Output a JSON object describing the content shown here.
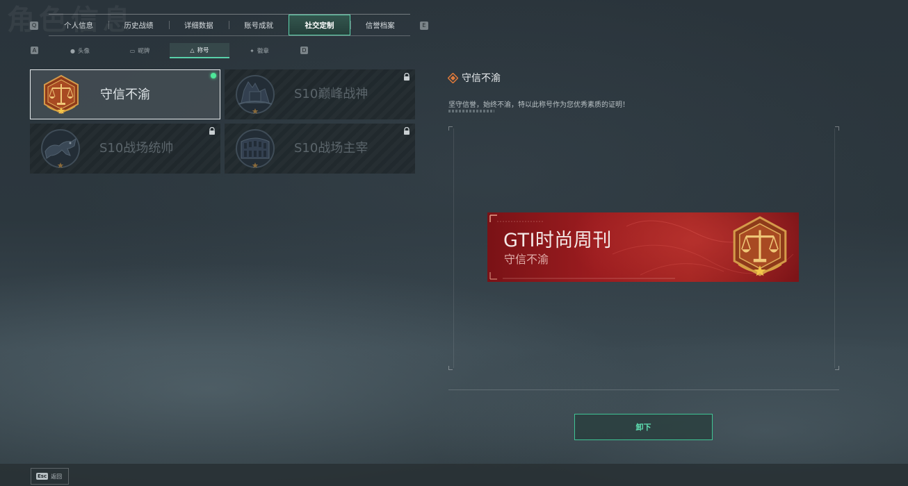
{
  "page": {
    "title": "角色信息"
  },
  "tabbar": {
    "left_key": "Q",
    "right_key": "E",
    "tabs": [
      {
        "label": "个人信息"
      },
      {
        "label": "历史战绩"
      },
      {
        "label": "详细数据"
      },
      {
        "label": "账号成就"
      },
      {
        "label": "社交定制",
        "active": true
      },
      {
        "label": "信誉档案"
      }
    ]
  },
  "subtabs": {
    "left_key": "A",
    "right_key": "D",
    "items": [
      {
        "label": "头像",
        "icon": "person-icon"
      },
      {
        "label": "昵牌",
        "icon": "nameplate-icon"
      },
      {
        "label": "称号",
        "icon": "title-triangle-icon",
        "active": true
      },
      {
        "label": "徽章",
        "icon": "badge-icon"
      }
    ]
  },
  "titles": [
    {
      "label": "守信不渝",
      "emblem": "scales-emblem",
      "selected": true,
      "equipped": true,
      "locked": false
    },
    {
      "label": "S10巅峰战神",
      "emblem": "wave-building-emblem",
      "selected": false,
      "equipped": false,
      "locked": true
    },
    {
      "label": "S10战场统帅",
      "emblem": "leopard-emblem",
      "selected": false,
      "equipped": false,
      "locked": true
    },
    {
      "label": "S10战场主宰",
      "emblem": "colosseum-emblem",
      "selected": false,
      "equipped": false,
      "locked": true
    }
  ],
  "detail": {
    "title": "守信不渝",
    "description": "坚守信誉，始终不渝，特以此称号作为您优秀素质的证明！"
  },
  "banner": {
    "name": "GTI时尚周刊",
    "title": "守信不渝",
    "colors": {
      "base": "#9b1c1f",
      "emblem": "#a0401c"
    }
  },
  "actions": {
    "unequip_label": "卸下",
    "esc_key": "Esc",
    "back_label": "返回"
  },
  "colors": {
    "accent": "#4fd3a5",
    "equipped_dot": "#4ee89a"
  }
}
